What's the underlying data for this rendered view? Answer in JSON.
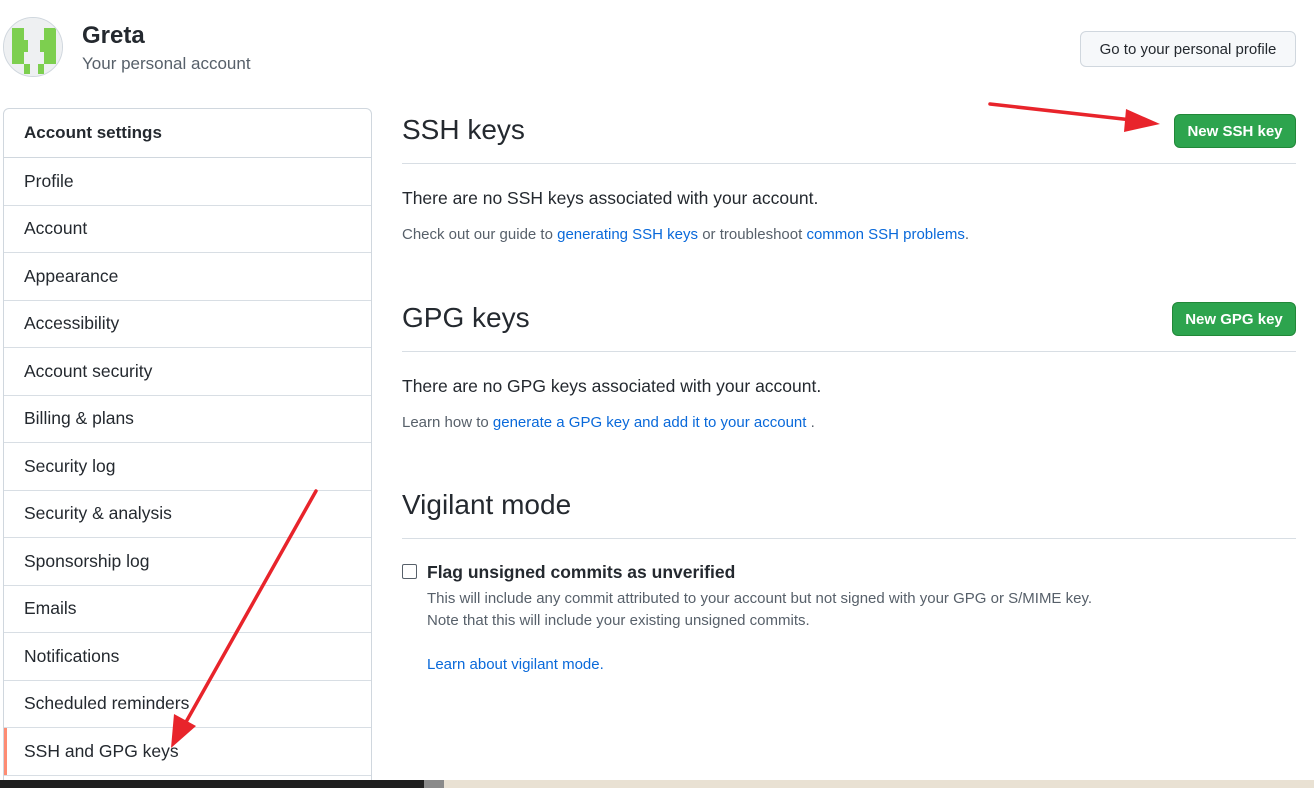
{
  "header": {
    "user_name": "Greta",
    "user_subtitle": "Your personal account",
    "profile_button": "Go to your personal profile"
  },
  "sidebar": {
    "header": "Account settings",
    "items": [
      {
        "label": "Profile"
      },
      {
        "label": "Account"
      },
      {
        "label": "Appearance"
      },
      {
        "label": "Accessibility"
      },
      {
        "label": "Account security"
      },
      {
        "label": "Billing & plans"
      },
      {
        "label": "Security log"
      },
      {
        "label": "Security & analysis"
      },
      {
        "label": "Sponsorship log"
      },
      {
        "label": "Emails"
      },
      {
        "label": "Notifications"
      },
      {
        "label": "Scheduled reminders"
      },
      {
        "label": "SSH and GPG keys"
      }
    ],
    "active_index": 12
  },
  "ssh": {
    "title": "SSH keys",
    "new_button": "New SSH key",
    "empty_text": "There are no SSH keys associated with your account.",
    "guide_prefix": "Check out our guide to ",
    "guide_link": "generating SSH keys",
    "guide_middle": " or troubleshoot ",
    "problems_link": "common SSH problems",
    "guide_suffix": "."
  },
  "gpg": {
    "title": "GPG keys",
    "new_button": "New GPG key",
    "empty_text": "There are no GPG keys associated with your account.",
    "learn_prefix": "Learn how to ",
    "learn_link": "generate a GPG key and add it to your account",
    "learn_suffix": " ."
  },
  "vigilant": {
    "title": "Vigilant mode",
    "checkbox_label": "Flag unsigned commits as unverified",
    "checked": false,
    "desc_line1": "This will include any commit attributed to your account but not signed with your GPG or S/MIME key.",
    "desc_line2": "Note that this will include your existing unsigned commits.",
    "learn_link": "Learn about vigilant mode",
    "learn_suffix": "."
  },
  "colors": {
    "green": "#2da44e",
    "link": "#0969da",
    "active_marker": "#fd8c73",
    "annotation_arrow": "#e8242b",
    "avatar_green": "#7dcf4f"
  }
}
